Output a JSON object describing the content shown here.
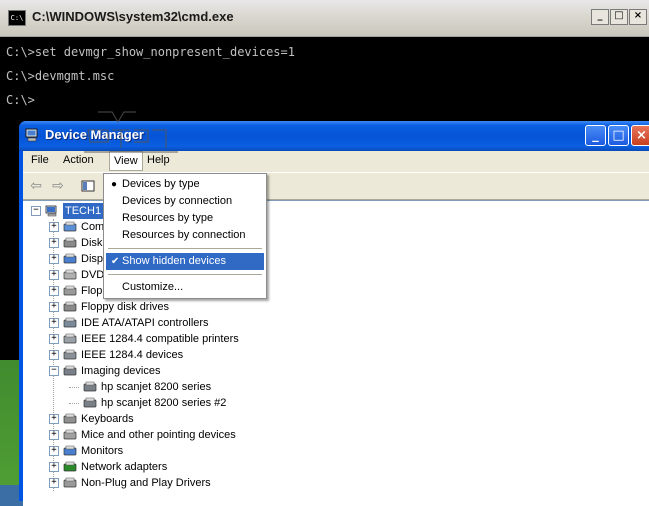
{
  "cmd": {
    "title": "C:\\WINDOWS\\system32\\cmd.exe",
    "icon_text": "C:\\",
    "lines": [
      "C:\\>set devmgr_show_nonpresent_devices=1",
      "C:\\>devmgmt.msc",
      "C:\\>"
    ]
  },
  "device_manager": {
    "title": "Device Manager",
    "menu": [
      "File",
      "Action",
      "View",
      "Help"
    ],
    "view_menu_items": [
      {
        "label": "Devices by type",
        "mark": "●",
        "highlighted": false
      },
      {
        "label": "Devices by connection",
        "mark": "",
        "highlighted": false
      },
      {
        "label": "Resources by type",
        "mark": "",
        "highlighted": false
      },
      {
        "label": "Resources by connection",
        "mark": "",
        "highlighted": false
      },
      {
        "label": "Show hidden devices",
        "mark": "✔",
        "highlighted": true
      },
      {
        "label": "Customize...",
        "mark": "",
        "highlighted": false
      }
    ],
    "tree_root": "TECH1",
    "tree_items": [
      {
        "label": "Com",
        "icon": "computer-icon",
        "expander": "+"
      },
      {
        "label": "Disk",
        "icon": "disk-drive-icon",
        "expander": "+"
      },
      {
        "label": "Disp",
        "icon": "display-adapter-icon",
        "expander": "+"
      },
      {
        "label": "DVD",
        "icon": "dvd-drive-icon",
        "expander": "+"
      },
      {
        "label": "Flop",
        "icon": "floppy-controller-icon",
        "expander": "+"
      },
      {
        "label": "Floppy disk drives",
        "icon": "floppy-drive-icon",
        "expander": "+"
      },
      {
        "label": "IDE ATA/ATAPI controllers",
        "icon": "ide-controller-icon",
        "expander": "+"
      },
      {
        "label": "IEEE 1284.4 compatible printers",
        "icon": "printer-icon",
        "expander": "+"
      },
      {
        "label": "IEEE 1284.4 devices",
        "icon": "ieee-device-icon",
        "expander": "+"
      },
      {
        "label": "Imaging devices",
        "icon": "scanner-icon",
        "expander": "−"
      },
      {
        "label": "hp scanjet 8200 series",
        "icon": "scanner-icon",
        "expander": "",
        "child": true
      },
      {
        "label": "hp scanjet 8200 series #2",
        "icon": "scanner-icon",
        "expander": "",
        "child": true
      },
      {
        "label": "Keyboards",
        "icon": "keyboard-icon",
        "expander": "+"
      },
      {
        "label": "Mice and other pointing devices",
        "icon": "mouse-icon",
        "expander": "+"
      },
      {
        "label": "Monitors",
        "icon": "monitor-icon",
        "expander": "+"
      },
      {
        "label": "Network adapters",
        "icon": "network-adapter-icon",
        "expander": "+"
      },
      {
        "label": "Non-Plug and Play Drivers",
        "icon": "driver-icon",
        "expander": "+"
      }
    ]
  },
  "colors": {
    "xp_blue": "#0054e3",
    "selection": "#316ac5",
    "cmd_bg": "#000000",
    "cmd_text": "#c0c0c0"
  }
}
